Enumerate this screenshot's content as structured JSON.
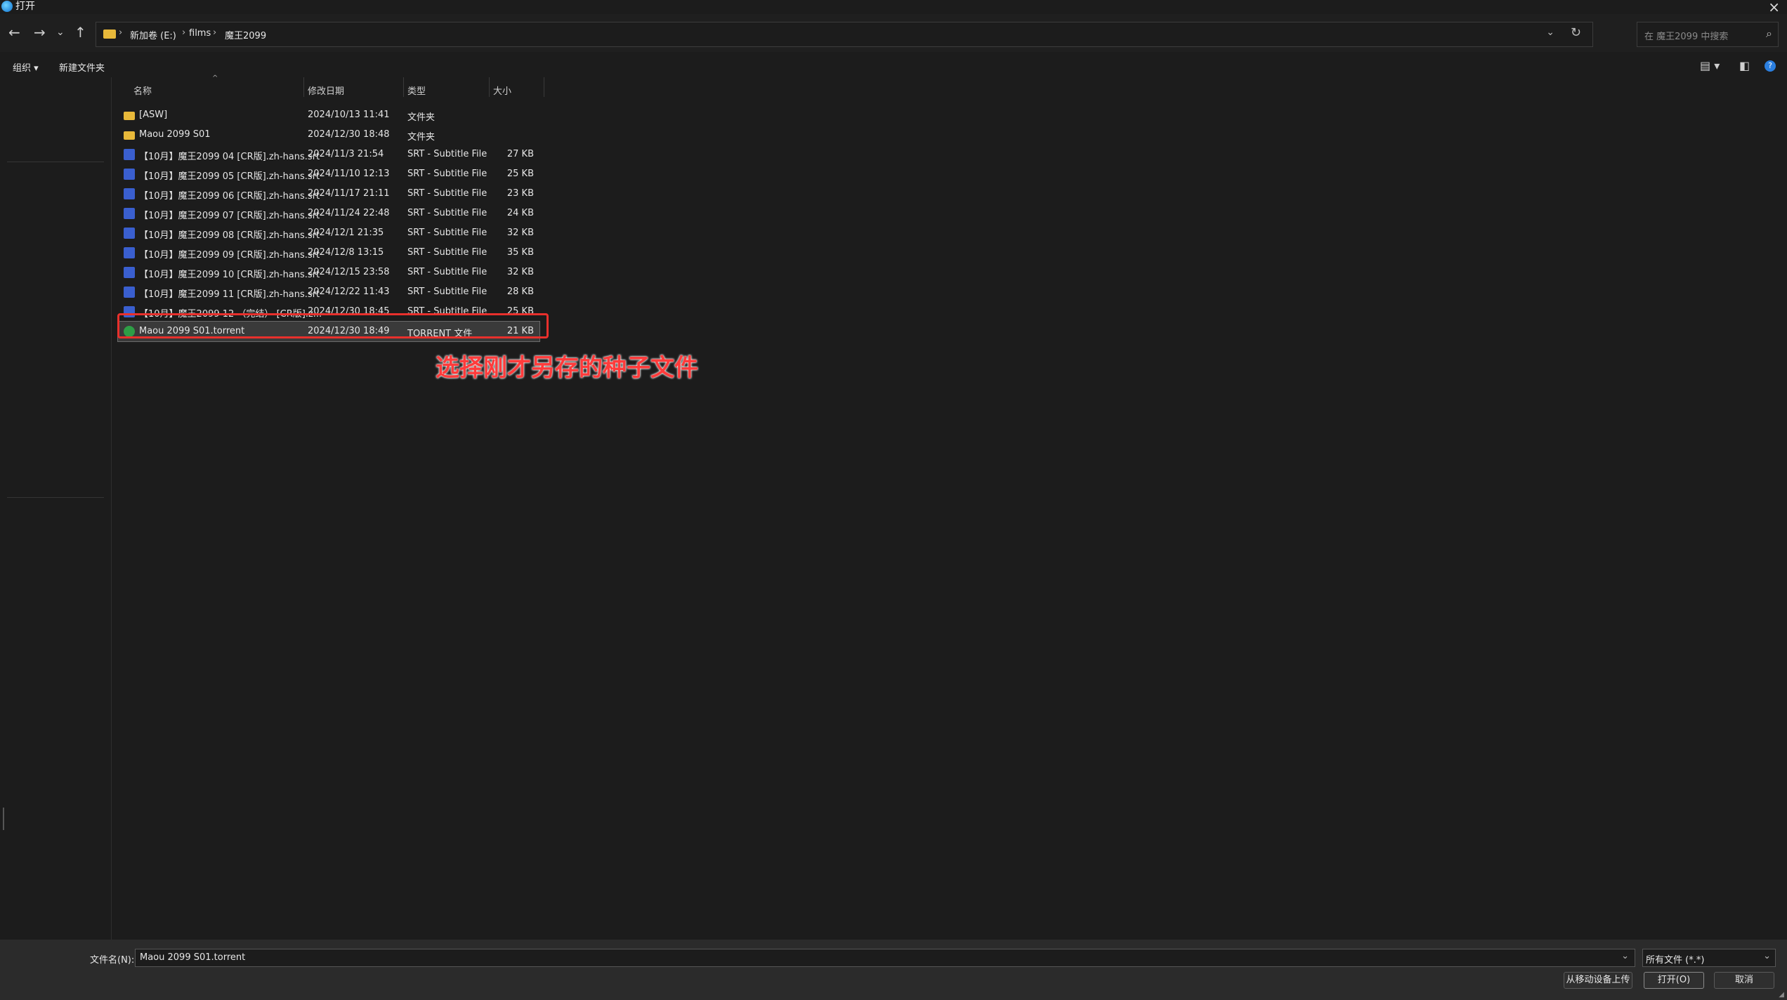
{
  "window": {
    "title": "打开"
  },
  "breadcrumb": [
    {
      "label": "新加卷 (E:)"
    },
    {
      "label": "films"
    },
    {
      "label": "魔王2099"
    }
  ],
  "search": {
    "placeholder": "在 魔王2099 中搜索"
  },
  "toolbar": {
    "organize": "组织 ▾",
    "new_folder": "新建文件夹"
  },
  "columns": {
    "name": "名称",
    "date": "修改日期",
    "type": "类型",
    "size": "大小"
  },
  "files": [
    {
      "icon": "folder-icon",
      "name": "[ASW]",
      "date": "2024/10/13 11:41",
      "type": "文件夹",
      "size": ""
    },
    {
      "icon": "folder-icon",
      "name": "Maou 2099 S01",
      "date": "2024/12/30 18:48",
      "type": "文件夹",
      "size": ""
    },
    {
      "icon": "srt-file-icon",
      "name": "【10月】魔王2099 04 [CR版].zh-hans.srt",
      "date": "2024/11/3 21:54",
      "type": "SRT - Subtitle File",
      "size": "27 KB"
    },
    {
      "icon": "srt-file-icon",
      "name": "【10月】魔王2099 05 [CR版].zh-hans.srt",
      "date": "2024/11/10 12:13",
      "type": "SRT - Subtitle File",
      "size": "25 KB"
    },
    {
      "icon": "srt-file-icon",
      "name": "【10月】魔王2099 06 [CR版].zh-hans.srt",
      "date": "2024/11/17 21:11",
      "type": "SRT - Subtitle File",
      "size": "23 KB"
    },
    {
      "icon": "srt-file-icon",
      "name": "【10月】魔王2099 07 [CR版].zh-hans.srt",
      "date": "2024/11/24 22:48",
      "type": "SRT - Subtitle File",
      "size": "24 KB"
    },
    {
      "icon": "srt-file-icon",
      "name": "【10月】魔王2099 08 [CR版].zh-hans.srt",
      "date": "2024/12/1 21:35",
      "type": "SRT - Subtitle File",
      "size": "32 KB"
    },
    {
      "icon": "srt-file-icon",
      "name": "【10月】魔王2099 09 [CR版].zh-hans.srt",
      "date": "2024/12/8 13:15",
      "type": "SRT - Subtitle File",
      "size": "35 KB"
    },
    {
      "icon": "srt-file-icon",
      "name": "【10月】魔王2099 10 [CR版].zh-hans.srt",
      "date": "2024/12/15 23:58",
      "type": "SRT - Subtitle File",
      "size": "32 KB"
    },
    {
      "icon": "srt-file-icon",
      "name": "【10月】魔王2099 11 [CR版].zh-hans.srt",
      "date": "2024/12/22 11:43",
      "type": "SRT - Subtitle File",
      "size": "28 KB"
    },
    {
      "icon": "srt-file-icon",
      "name": "【10月】魔王2099 12 （完结） [CR版].z...",
      "date": "2024/12/30 18:45",
      "type": "SRT - Subtitle File",
      "size": "25 KB"
    },
    {
      "icon": "torrent-file-icon",
      "name": "Maou 2099 S01.torrent",
      "date": "2024/12/30 18:49",
      "type": "TORRENT 文件",
      "size": "21 KB",
      "selected": true
    }
  ],
  "annotation": "选择刚才另存的种子文件",
  "bottom": {
    "filename_label": "文件名(N):",
    "filename_value": "Maou 2099 S01.torrent",
    "filetype_value": "所有文件 (*.*)",
    "upload_button": "从移动设备上传",
    "open_button": "打开(O)",
    "cancel_button": "取消"
  },
  "colors": {
    "highlight": "#e8302c",
    "annotation": "#ff3b3b"
  }
}
